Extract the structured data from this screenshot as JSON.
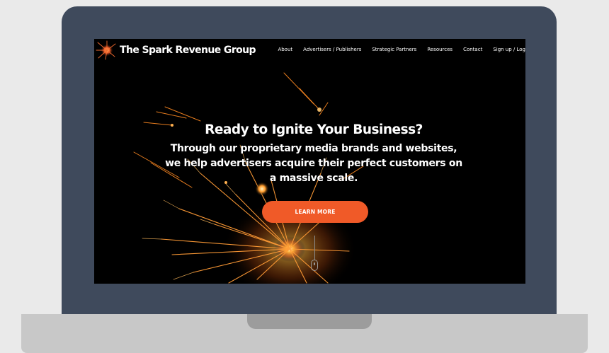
{
  "site": {
    "brand_name": "The Spark Revenue Group"
  },
  "nav": {
    "items": [
      {
        "label": "About"
      },
      {
        "label": "Advertisers / Publishers"
      },
      {
        "label": "Strategic Partners"
      },
      {
        "label": "Resources"
      },
      {
        "label": "Contact"
      },
      {
        "label": "Sign up / Log"
      }
    ]
  },
  "hero": {
    "title": "Ready to Ignite Your Business?",
    "subtitle": "Through our proprietary media brands and websites, we help advertisers acquire their perfect customers on a massive scale.",
    "cta_label": "LEARN MORE"
  },
  "icons": {
    "logo": "spark-burst-icon",
    "scroll": "scroll-mouse-icon"
  },
  "colors": {
    "accent": "#f05a28",
    "laptop_frame": "#3f4a5c",
    "screen_background": "#000000",
    "text": "#ffffff"
  }
}
